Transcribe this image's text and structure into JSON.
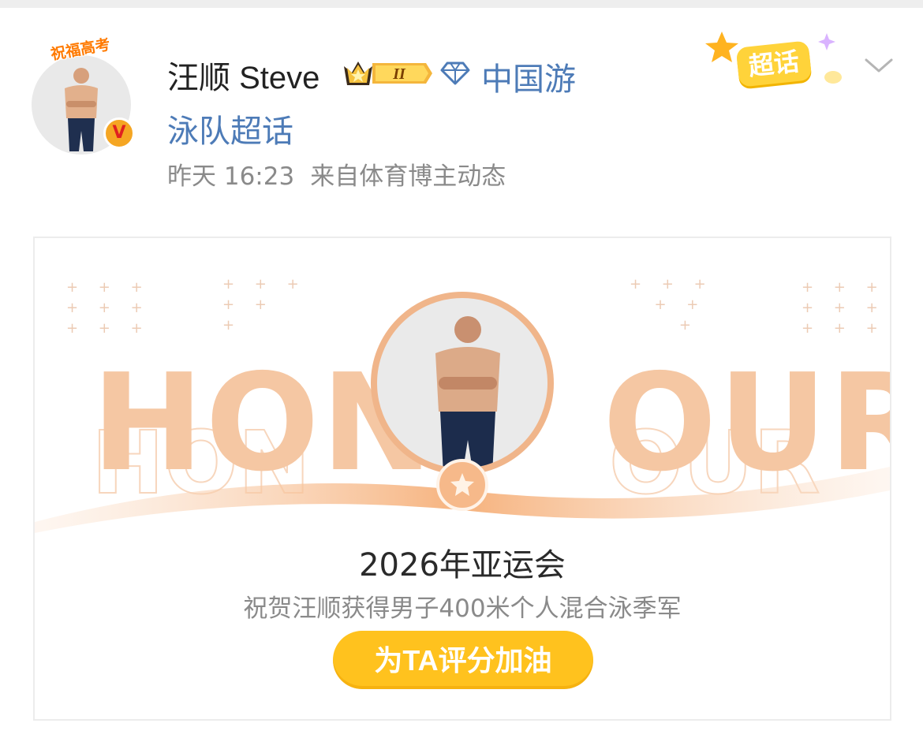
{
  "post": {
    "avatar_banner": "祝福高考",
    "verified_mark": "V",
    "username": "汪顺 Steve",
    "level_badge": "II",
    "topic_line1": "中国游",
    "topic_line2": "泳队超话",
    "time": "昨天 16:23",
    "source": "来自体育博主动态",
    "chaohua_label": "超话"
  },
  "card": {
    "honour_left": "HON",
    "honour_right": "OUR",
    "event_title": "2026年亚运会",
    "event_subtitle": "祝贺汪顺获得男子400米个人混合泳季军",
    "button_label": "为TA评分加油"
  },
  "colors": {
    "topic_blue": "#4d7bb7",
    "button_yellow": "#ffc21e",
    "honour_orange": "#f5c7a3"
  },
  "icons": [
    "verified-icon",
    "crown-badge-icon",
    "diamond-icon",
    "chaohua-icon",
    "chevron-down-icon",
    "medal-icon"
  ]
}
